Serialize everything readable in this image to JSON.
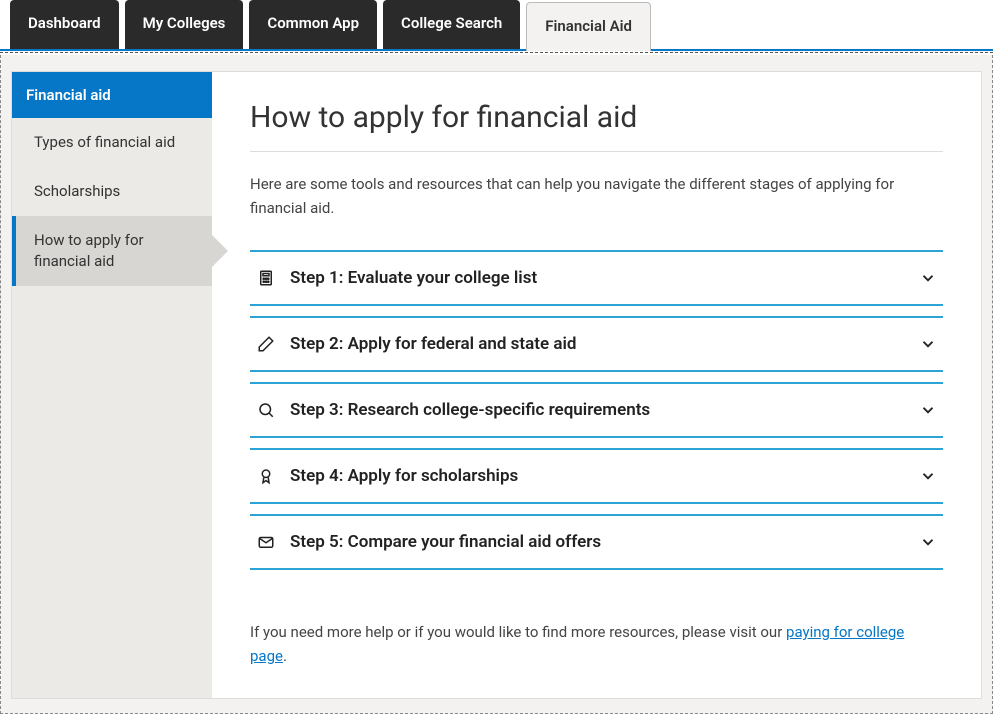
{
  "tabs": [
    {
      "label": "Dashboard"
    },
    {
      "label": "My Colleges"
    },
    {
      "label": "Common App"
    },
    {
      "label": "College Search"
    },
    {
      "label": "Financial Aid"
    }
  ],
  "sidebar": {
    "header": "Financial aid",
    "items": [
      {
        "label": "Types of financial aid"
      },
      {
        "label": "Scholarships"
      },
      {
        "label": "How to apply for financial aid"
      }
    ]
  },
  "main": {
    "title": "How to apply for financial aid",
    "intro": "Here are some tools and resources that can help you navigate the different stages of applying for financial aid.",
    "steps": [
      {
        "icon": "calculator-icon",
        "label": "Step 1: Evaluate your college list"
      },
      {
        "icon": "pencil-icon",
        "label": "Step 2: Apply for federal and state aid"
      },
      {
        "icon": "search-icon",
        "label": "Step 3: Research college-specific requirements"
      },
      {
        "icon": "award-icon",
        "label": "Step 4: Apply for scholarships"
      },
      {
        "icon": "envelope-icon",
        "label": "Step 5: Compare your financial aid offers"
      }
    ],
    "footer_prefix": "If you need more help or if you would like to find more resources, please visit our ",
    "footer_link": "paying for college page",
    "footer_suffix": "."
  }
}
